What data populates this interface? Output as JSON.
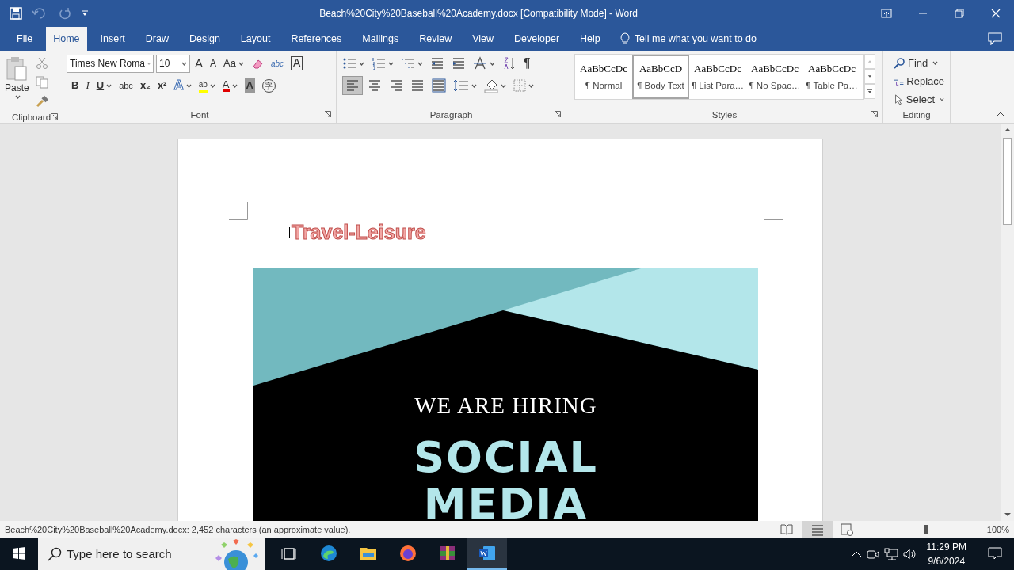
{
  "title_bar": {
    "title": "Beach%20City%20Baseball%20Academy.docx [Compatibility Mode]  -  Word"
  },
  "tabs": [
    {
      "label": "File",
      "selected": false
    },
    {
      "label": "Home",
      "selected": true
    },
    {
      "label": "Insert",
      "selected": false
    },
    {
      "label": "Draw",
      "selected": false
    },
    {
      "label": "Design",
      "selected": false
    },
    {
      "label": "Layout",
      "selected": false
    },
    {
      "label": "References",
      "selected": false
    },
    {
      "label": "Mailings",
      "selected": false
    },
    {
      "label": "Review",
      "selected": false
    },
    {
      "label": "View",
      "selected": false
    },
    {
      "label": "Developer",
      "selected": false
    },
    {
      "label": "Help",
      "selected": false
    }
  ],
  "tell_me": {
    "placeholder": "Tell me what you want to do"
  },
  "clipboard": {
    "paste_label": "Paste",
    "group_label": "Clipboard"
  },
  "font": {
    "font_name": "Times New Roma",
    "font_size": "10",
    "group_label": "Font",
    "row1": [
      {
        "kind": "grow",
        "glyph": "A"
      },
      {
        "kind": "shrink",
        "glyph": "A"
      },
      {
        "kind": "case",
        "glyph": "Aa",
        "dropdown": true
      },
      {
        "kind": "clear"
      },
      {
        "kind": "phonetic",
        "glyph": "abc"
      },
      {
        "kind": "boxed",
        "glyph": "A"
      }
    ],
    "row2": [
      {
        "kind": "bold",
        "glyph": "B"
      },
      {
        "kind": "italic",
        "glyph": "I"
      },
      {
        "kind": "underline",
        "glyph": "U",
        "dropdown": true
      },
      {
        "kind": "strike",
        "glyph": "abc"
      },
      {
        "kind": "sub",
        "glyph": "x₂"
      },
      {
        "kind": "sup",
        "glyph": "x²"
      },
      {
        "kind": "effects",
        "glyph": "A",
        "dropdown": true
      },
      {
        "kind": "highlight",
        "glyph": "ab",
        "dropdown": true
      },
      {
        "kind": "color",
        "glyph": "A",
        "dropdown": true
      },
      {
        "kind": "shading",
        "glyph": "A"
      },
      {
        "kind": "enclose",
        "glyph": "字"
      }
    ]
  },
  "paragraph": {
    "group_label": "Paragraph",
    "pilcrow": "¶",
    "alignments": [
      {
        "kind": "left",
        "selected": true
      },
      {
        "kind": "center",
        "selected": false
      },
      {
        "kind": "right",
        "selected": false
      },
      {
        "kind": "justify",
        "selected": false
      },
      {
        "kind": "distribute",
        "selected": false
      }
    ]
  },
  "styles": {
    "group_label": "Styles",
    "items": [
      {
        "sample": "AaBbCcDc",
        "name": "¶ Normal",
        "selected": false
      },
      {
        "sample": "AaBbCcD",
        "name": "¶ Body Text",
        "selected": true
      },
      {
        "sample": "AaBbCcDc",
        "name": "¶ List Para…",
        "selected": false
      },
      {
        "sample": "AaBbCcDc",
        "name": "¶ No Spac…",
        "selected": false
      },
      {
        "sample": "AaBbCcDc",
        "name": "¶ Table Pa…",
        "selected": false
      }
    ]
  },
  "editing": {
    "group_label": "Editing",
    "items": [
      {
        "kind": "find",
        "label": "Find"
      },
      {
        "kind": "replace",
        "label": "Replace"
      },
      {
        "kind": "select",
        "label": "Select"
      }
    ]
  },
  "document": {
    "heading": "Travel-Leisure",
    "flyer": {
      "kicker": "WE ARE HIRING",
      "line1": "SOCIAL",
      "line2": "MEDIA"
    }
  },
  "status_bar": {
    "text": "Beach%20City%20Baseball%20Academy.docx: 2,452 characters (an approximate value).",
    "views": [
      {
        "kind": "read",
        "selected": false
      },
      {
        "kind": "print",
        "selected": true
      },
      {
        "kind": "web",
        "selected": false
      }
    ],
    "zoom": {
      "level": 0.5,
      "reading": "100%"
    }
  },
  "taskbar": {
    "search_placeholder": "Type here to search",
    "apps": [
      {
        "kind": "taskview",
        "selected": false
      },
      {
        "kind": "edge",
        "selected": false
      },
      {
        "kind": "explorer",
        "selected": false
      },
      {
        "kind": "firefox",
        "selected": false
      },
      {
        "kind": "winrar",
        "selected": false
      },
      {
        "kind": "word",
        "selected": true
      }
    ],
    "time": "11:29 PM",
    "date": "9/6/2024"
  }
}
